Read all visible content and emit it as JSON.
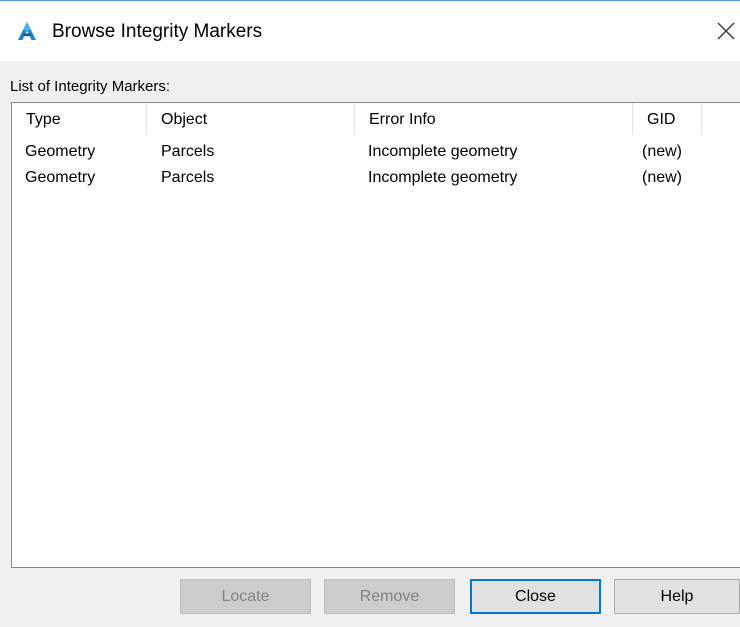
{
  "window": {
    "title": "Browse Integrity Markers",
    "app_icon": "autocad-a-icon",
    "close_icon": "close-icon",
    "accent_color": "#0078d7"
  },
  "list": {
    "caption": "List of Integrity Markers:",
    "columns": [
      "Type",
      "Object",
      "Error Info",
      "GID"
    ],
    "rows": [
      [
        "Geometry",
        "Parcels",
        "Incomplete geometry",
        "(new)"
      ],
      [
        "Geometry",
        "Parcels",
        "Incomplete geometry",
        "(new)"
      ]
    ]
  },
  "buttons": {
    "locate": {
      "label": "Locate",
      "enabled": false
    },
    "remove": {
      "label": "Remove",
      "enabled": false
    },
    "close": {
      "label": "Close",
      "enabled": true,
      "default": true
    },
    "help": {
      "label": "Help",
      "enabled": true
    }
  }
}
